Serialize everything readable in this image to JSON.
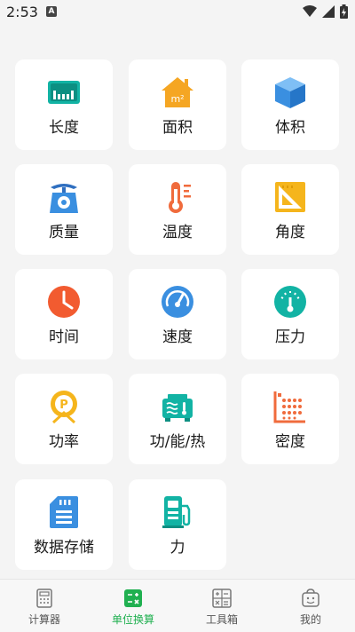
{
  "status_bar": {
    "time": "2:53",
    "notification_badge": "A"
  },
  "categories": [
    {
      "label": "长度",
      "icon": "ruler-icon"
    },
    {
      "label": "面积",
      "icon": "house-area-icon",
      "icon_text": "m²"
    },
    {
      "label": "体积",
      "icon": "cube-icon"
    },
    {
      "label": "质量",
      "icon": "scale-icon"
    },
    {
      "label": "温度",
      "icon": "thermometer-icon"
    },
    {
      "label": "角度",
      "icon": "set-square-icon"
    },
    {
      "label": "时间",
      "icon": "clock-icon"
    },
    {
      "label": "速度",
      "icon": "speedometer-icon"
    },
    {
      "label": "压力",
      "icon": "pressure-gauge-icon"
    },
    {
      "label": "功率",
      "icon": "power-icon",
      "icon_text": "P"
    },
    {
      "label": "功/能/热",
      "icon": "heater-icon"
    },
    {
      "label": "密度",
      "icon": "density-icon"
    },
    {
      "label": "数据存储",
      "icon": "sd-card-icon"
    },
    {
      "label": "力",
      "icon": "fuel-pump-icon"
    }
  ],
  "bottom_nav": [
    {
      "label": "计算器",
      "icon": "calculator-icon",
      "active": false
    },
    {
      "label": "单位换算",
      "icon": "unit-convert-icon",
      "active": true
    },
    {
      "label": "工具箱",
      "icon": "toolbox-icon",
      "active": false
    },
    {
      "label": "我的",
      "icon": "profile-icon",
      "active": false
    }
  ],
  "colors": {
    "active": "#20b050",
    "inactive": "#555555",
    "card": "#ffffff",
    "background": "#f4f4f4"
  }
}
